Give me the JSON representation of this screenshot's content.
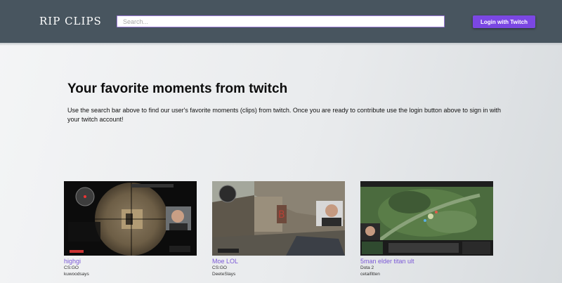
{
  "navbar": {
    "logo": "RIP CLIPS",
    "search_placeholder": "Search...",
    "login_label": "Login with Twitch"
  },
  "hero": {
    "title": "Your favorite moments from twitch",
    "description": "Use the search bar above to find our user's favorite moments (clips) from twitch. Once you are ready to contribute use the login button above to sign in with your twitch account!"
  },
  "clips": [
    {
      "title": "highgi",
      "game": "CS:GO",
      "user": "kuwoodsays"
    },
    {
      "title": "Moe LOL",
      "game": "CS:GO",
      "user": "DeeteSlays"
    },
    {
      "title": "5man elder titan ult",
      "game": "Dota 2",
      "user": "cetaifitten"
    }
  ],
  "colors": {
    "navbar": "#48555f",
    "accent": "#7b47e3",
    "clip_link": "#7b59d6"
  }
}
